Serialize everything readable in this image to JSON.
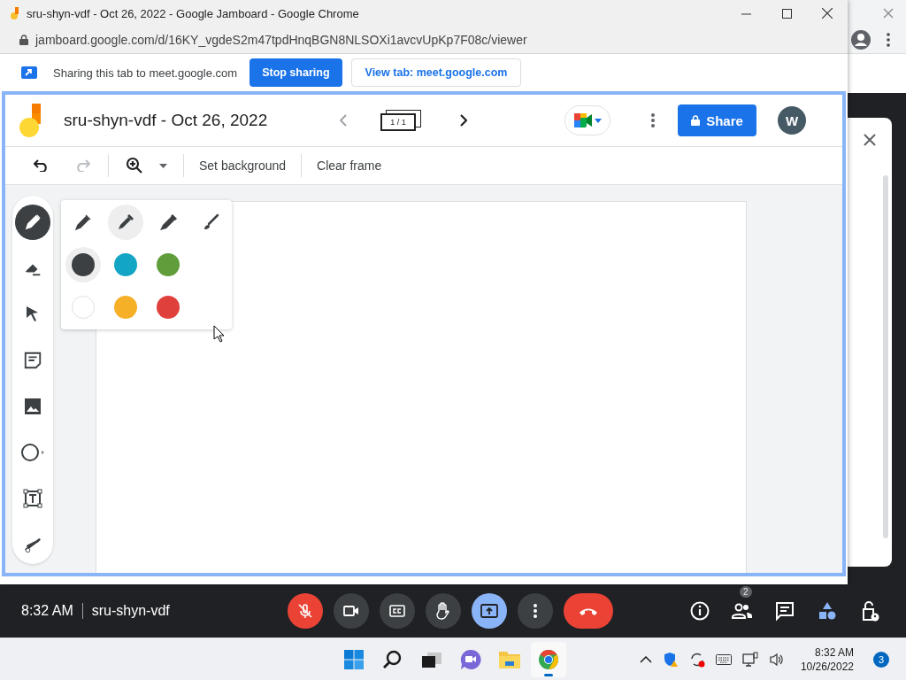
{
  "browser": {
    "title": "sru-shyn-vdf - Oct 26, 2022 - Google Jamboard - Google Chrome",
    "url": "jamboard.google.com/d/16KY_vgdeS2m47tpdHnqBGN8NLSOXi1avcvUpKp7F08c/viewer"
  },
  "sharing_bar": {
    "message": "Sharing this tab to meet.google.com",
    "buttons": [
      {
        "label": "Stop sharing",
        "kind": "primary"
      },
      {
        "label": "View tab: meet.google.com",
        "kind": "outline"
      }
    ]
  },
  "jamboard": {
    "title": "sru-shyn-vdf - Oct 26, 2022",
    "frame_counter": "1 / 1",
    "share_label": "Share",
    "avatar_letter": "W",
    "toolbar_buttons": [
      "Set background",
      "Clear frame"
    ]
  },
  "tools": [
    {
      "kind": "pen",
      "selected": true
    },
    {
      "kind": "eraser",
      "selected": false
    },
    {
      "kind": "select",
      "selected": false
    },
    {
      "kind": "note",
      "selected": false
    },
    {
      "kind": "image",
      "selected": false
    },
    {
      "kind": "shape",
      "selected": false
    },
    {
      "kind": "textbox",
      "selected": false
    },
    {
      "kind": "laser",
      "selected": false
    }
  ],
  "pens": [
    {
      "kind": "pen",
      "selected": false
    },
    {
      "kind": "marker",
      "selected": true
    },
    {
      "kind": "highlighter",
      "selected": false
    },
    {
      "kind": "brush",
      "selected": false
    }
  ],
  "colors": [
    {
      "color": "#3c4043",
      "selected": true
    },
    {
      "color": "#12a5c4",
      "selected": false
    },
    {
      "color": "#5f9e3a",
      "selected": false
    },
    {
      "color": "#ffffff",
      "selected": false
    },
    {
      "color": "#f5b027",
      "selected": false
    },
    {
      "color": "#e0403c",
      "selected": false
    }
  ],
  "meet_bar": {
    "time": "8:32 AM",
    "meeting_code": "sru-shyn-vdf",
    "participants_badge": "2",
    "controls": [
      {
        "kind": "mic"
      },
      {
        "kind": "camera"
      },
      {
        "kind": "captions"
      },
      {
        "kind": "hand"
      },
      {
        "kind": "present"
      },
      {
        "kind": "more"
      },
      {
        "kind": "leave"
      }
    ],
    "side_controls": [
      {
        "kind": "info"
      },
      {
        "kind": "people"
      },
      {
        "kind": "chat"
      },
      {
        "kind": "activities"
      },
      {
        "kind": "host"
      }
    ]
  },
  "taskbar": {
    "time": "8:32 AM",
    "date": "10/26/2022",
    "notification_count": "3",
    "apps": [
      {
        "kind": "start",
        "running": false
      },
      {
        "kind": "search",
        "running": false
      },
      {
        "kind": "taskview",
        "running": false
      },
      {
        "kind": "chat",
        "running": false
      },
      {
        "kind": "explorer",
        "running": false
      },
      {
        "kind": "chrome",
        "running": true
      }
    ]
  }
}
